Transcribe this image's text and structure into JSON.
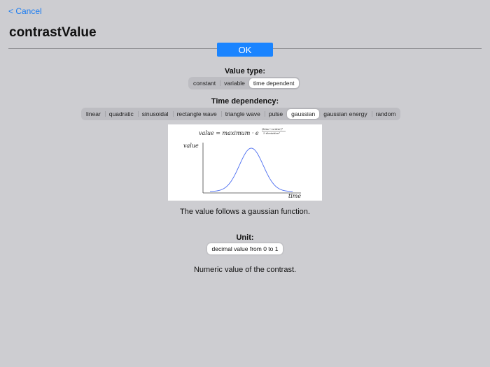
{
  "nav": {
    "cancel_label": "< Cancel"
  },
  "page": {
    "title": "contrastValue",
    "ok_label": "OK"
  },
  "value_type": {
    "label": "Value type:",
    "options": [
      "constant",
      "variable",
      "time dependent"
    ],
    "selected": "time dependent"
  },
  "time_dependency": {
    "label": "Time dependency:",
    "options": [
      "linear",
      "quadratic",
      "sinusoidal",
      "rectangle wave",
      "triangle wave",
      "pulse",
      "gaussian",
      "gaussian energy",
      "random"
    ],
    "selected": "gaussian"
  },
  "graph": {
    "formula_lhs": "value = maximum · e",
    "formula_num": "(time−center)²",
    "formula_den": "2·deviation²",
    "y_label": "value",
    "x_label": "time",
    "curve_color": "#4a6cf0"
  },
  "function_description": "The value follows a gaussian function.",
  "unit": {
    "label": "Unit:",
    "value": "decimal value from 0 to 1"
  },
  "unit_description": "Numeric value of the contrast.",
  "colors": {
    "accent": "#1a84ff",
    "link": "#1a7cf2",
    "background": "#cdcdd1"
  }
}
